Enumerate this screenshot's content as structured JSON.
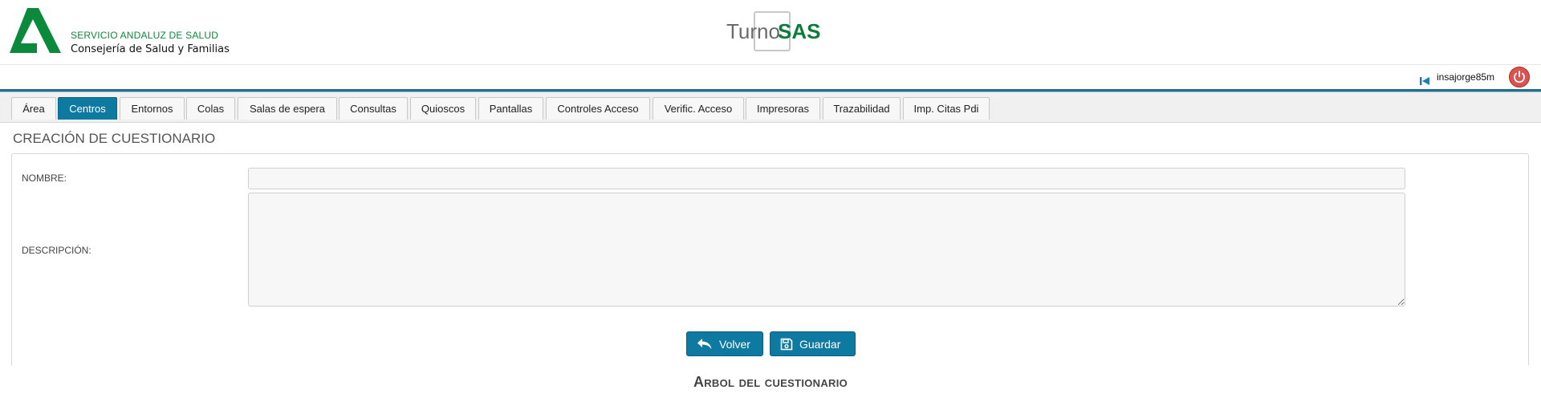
{
  "header": {
    "org_line1": "SERVICIO ANDALUZ DE SALUD",
    "org_line2": "Consejería de Salud y Familias",
    "brand_turno": "Turno",
    "brand_sas": "SAS"
  },
  "user": {
    "username": "insajorge85m"
  },
  "tabs": [
    {
      "label": "Área"
    },
    {
      "label": "Centros",
      "active": true
    },
    {
      "label": "Entornos"
    },
    {
      "label": "Colas"
    },
    {
      "label": "Salas de espera"
    },
    {
      "label": "Consultas"
    },
    {
      "label": "Quioscos"
    },
    {
      "label": "Pantallas"
    },
    {
      "label": "Controles Acceso"
    },
    {
      "label": "Verific. Acceso"
    },
    {
      "label": "Impresoras"
    },
    {
      "label": "Trazabilidad"
    },
    {
      "label": "Imp. Citas Pdi"
    }
  ],
  "form": {
    "title": "CREACIÓN DE CUESTIONARIO",
    "name_label": "NOMBRE:",
    "name_value": "",
    "description_label": "DESCRIPCIÓN:",
    "description_value": "",
    "back_button": "Volver",
    "save_button": "Guardar"
  },
  "tree": {
    "heading": "Arbol del cuestionario"
  },
  "colors": {
    "accent": "#0e7aa2",
    "brand_green": "#0b7d3a",
    "power_red": "#d9534f"
  },
  "icons": {
    "back": "skip-back-icon",
    "power": "power-icon",
    "volver": "reply-arrow-icon",
    "guardar": "floppy-disk-icon"
  }
}
